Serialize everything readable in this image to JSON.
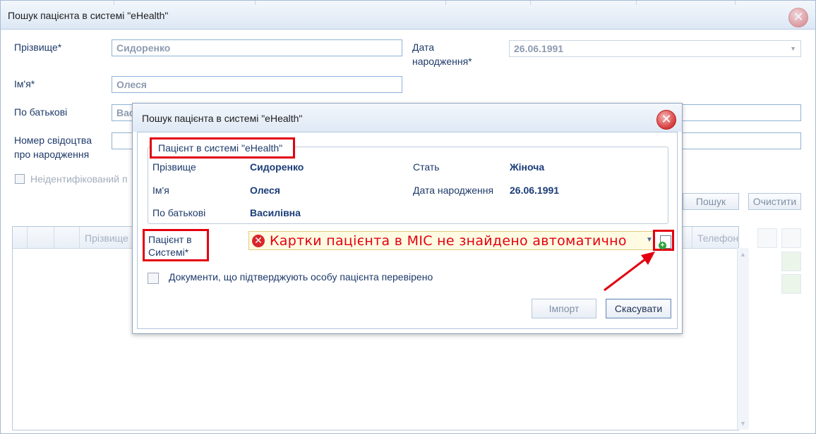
{
  "outer": {
    "title": "Пошук пацієнта в системі \"eHealth\"",
    "surname_label": "Прізвище*",
    "surname_value": "Сидоренко",
    "name_label": "Ім'я*",
    "name_value": "Олеся",
    "patronymic_label": "По батькові",
    "patronymic_value": "Вас",
    "birth_cert_label_1": "Номер свідоцтва",
    "birth_cert_label_2": "про народження",
    "dob_label_1": "Дата",
    "dob_label_2": "народження*",
    "dob_value": "26.06.1991",
    "unidentified_label": "Неідентифікований п",
    "search_button": "Пошук",
    "clear_button": "Очистити",
    "grid_columns": [
      "Прізвище",
      "Телефон"
    ]
  },
  "modal": {
    "title": "Пошук пацієнта в системі \"eHealth\"",
    "group_title": "Пацієнт в системі \"eHealth\"",
    "surname_label": "Прізвище",
    "surname_value": "Сидоренко",
    "name_label": "Ім'я",
    "name_value": "Олеся",
    "patronymic_label": "По батькові",
    "patronymic_value": "Василівна",
    "gender_label": "Стать",
    "gender_value": "Жіноча",
    "dob_label": "Дата народження",
    "dob_value": "26.06.1991",
    "patient_in_system_label_1": "Пацієнт в",
    "patient_in_system_label_2": "Системі*",
    "combo_error_text": "Картки пацієнта в МІС не знайдено автоматично",
    "docs_checked_label": "Документи, що підтверджують особу пацієнта перевірено",
    "import_button": "Імпорт",
    "cancel_button": "Скасувати"
  },
  "colors": {
    "highlight": "#e3000f",
    "accent": "#1b3d78",
    "title_bar": "#dde8f5"
  }
}
